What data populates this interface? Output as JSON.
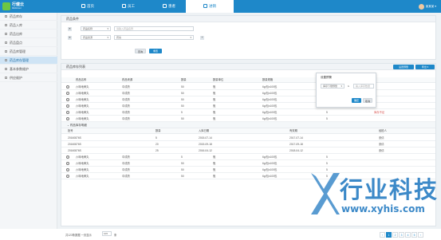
{
  "app": {
    "logo_title": "行健云",
    "logo_subtitle": "MEDcloud",
    "user_name": "某某某"
  },
  "nav": [
    {
      "label": "首页"
    },
    {
      "label": "员工"
    },
    {
      "label": "患者"
    },
    {
      "label": "进销"
    }
  ],
  "sidebar": {
    "items": [
      {
        "label": "药品库存"
      },
      {
        "label": "药品入库"
      },
      {
        "label": "药品出库"
      },
      {
        "label": "药品盘点"
      },
      {
        "label": "药品库管理"
      },
      {
        "label": "药品库存管理"
      },
      {
        "label": "基本参数维护"
      },
      {
        "label": "供应维护"
      }
    ]
  },
  "filter": {
    "title": "药品条件",
    "row1": {
      "select": "药品名称",
      "input_placeholder": "请输入药品名称"
    },
    "row2": {
      "select": "药品来源",
      "value": "药房"
    },
    "query_label": "查询",
    "reset_label": "重置"
  },
  "list": {
    "title": "药品库存列表",
    "btn_setting": "设置预警",
    "btn_export": "导出",
    "columns": [
      "药品名称",
      "药品来源",
      "数量",
      "数量单位",
      "数量规格",
      "库存下限"
    ],
    "rows": [
      {
        "name": "六味地黄丸",
        "source": "中成药",
        "qty": "50",
        "unit": "瓶",
        "spec": "6g/包x100包",
        "min": "5",
        "warn": ""
      },
      {
        "name": "六味地黄丸",
        "source": "中成药",
        "qty": "50",
        "unit": "瓶",
        "spec": "6g/包x100包",
        "min": "5",
        "warn": ""
      },
      {
        "name": "六味地黄丸",
        "source": "中成药",
        "qty": "50",
        "unit": "瓶",
        "spec": "6g/包x100包",
        "min": "5",
        "warn": ""
      },
      {
        "name": "六味地黄丸",
        "source": "中成药",
        "qty": "50",
        "unit": "瓶",
        "spec": "6g/包x100包",
        "min": "5",
        "warn": ""
      },
      {
        "name": "六味地黄丸",
        "source": "中成药",
        "qty": "5",
        "unit": "瓶",
        "spec": "6g/包x100包",
        "min": "5",
        "warn": "库存不足"
      },
      {
        "name": "六味地黄丸",
        "source": "中成药",
        "qty": "50",
        "unit": "瓶",
        "spec": "6g/包x100包",
        "min": "5",
        "warn": ""
      }
    ],
    "detail": {
      "title": "药品库存明细",
      "columns": [
        "批号",
        "数量",
        "入库日期",
        "有效期",
        "经检人"
      ],
      "rows": [
        {
          "batch": "20160876S",
          "qty": "5",
          "in_date": "2015-07-14",
          "expiry": "2017-07-14",
          "inspector": "张倩"
        },
        {
          "batch": "20160876S",
          "qty": "20",
          "in_date": "2015-09-18",
          "expiry": "2017-09-18",
          "inspector": "张倩"
        },
        {
          "batch": "20160876S",
          "qty": "25",
          "in_date": "2016-04-12",
          "expiry": "2018-04-12",
          "inspector": "张倩"
        }
      ]
    },
    "rows_after": [
      {
        "name": "六味地黄丸",
        "source": "中成药",
        "qty": "5",
        "unit": "瓶",
        "spec": "6g/包x100包",
        "min": "5"
      },
      {
        "name": "六味地黄丸",
        "source": "中成药",
        "qty": "50",
        "unit": "瓶",
        "spec": "6g/包x100包",
        "min": "5"
      },
      {
        "name": "六味地黄丸",
        "source": "中成药",
        "qty": "50",
        "unit": "瓶",
        "spec": "6g/包x100包",
        "min": "5"
      },
      {
        "name": "六味地黄丸",
        "source": "中成药",
        "qty": "50",
        "unit": "瓶",
        "spec": "6g/包x100包",
        "min": "5"
      }
    ]
  },
  "popup": {
    "title": "设置预警",
    "select": "库存下限预警",
    "op": "≤",
    "input_placeholder": "输入库存数量",
    "confirm": "确定",
    "cancel": "取消"
  },
  "footer": {
    "summary": "共123条数据 一页显示",
    "page_size": "10",
    "unit": "条",
    "pages": [
      "1",
      "2",
      "3",
      "4",
      "5"
    ],
    "prev": "‹",
    "next": "›"
  },
  "watermark": {
    "brand": "行业科技",
    "url": "www.xyhis.com"
  },
  "colors": {
    "primary": "#1e88c9",
    "warning": "#d9534f"
  }
}
